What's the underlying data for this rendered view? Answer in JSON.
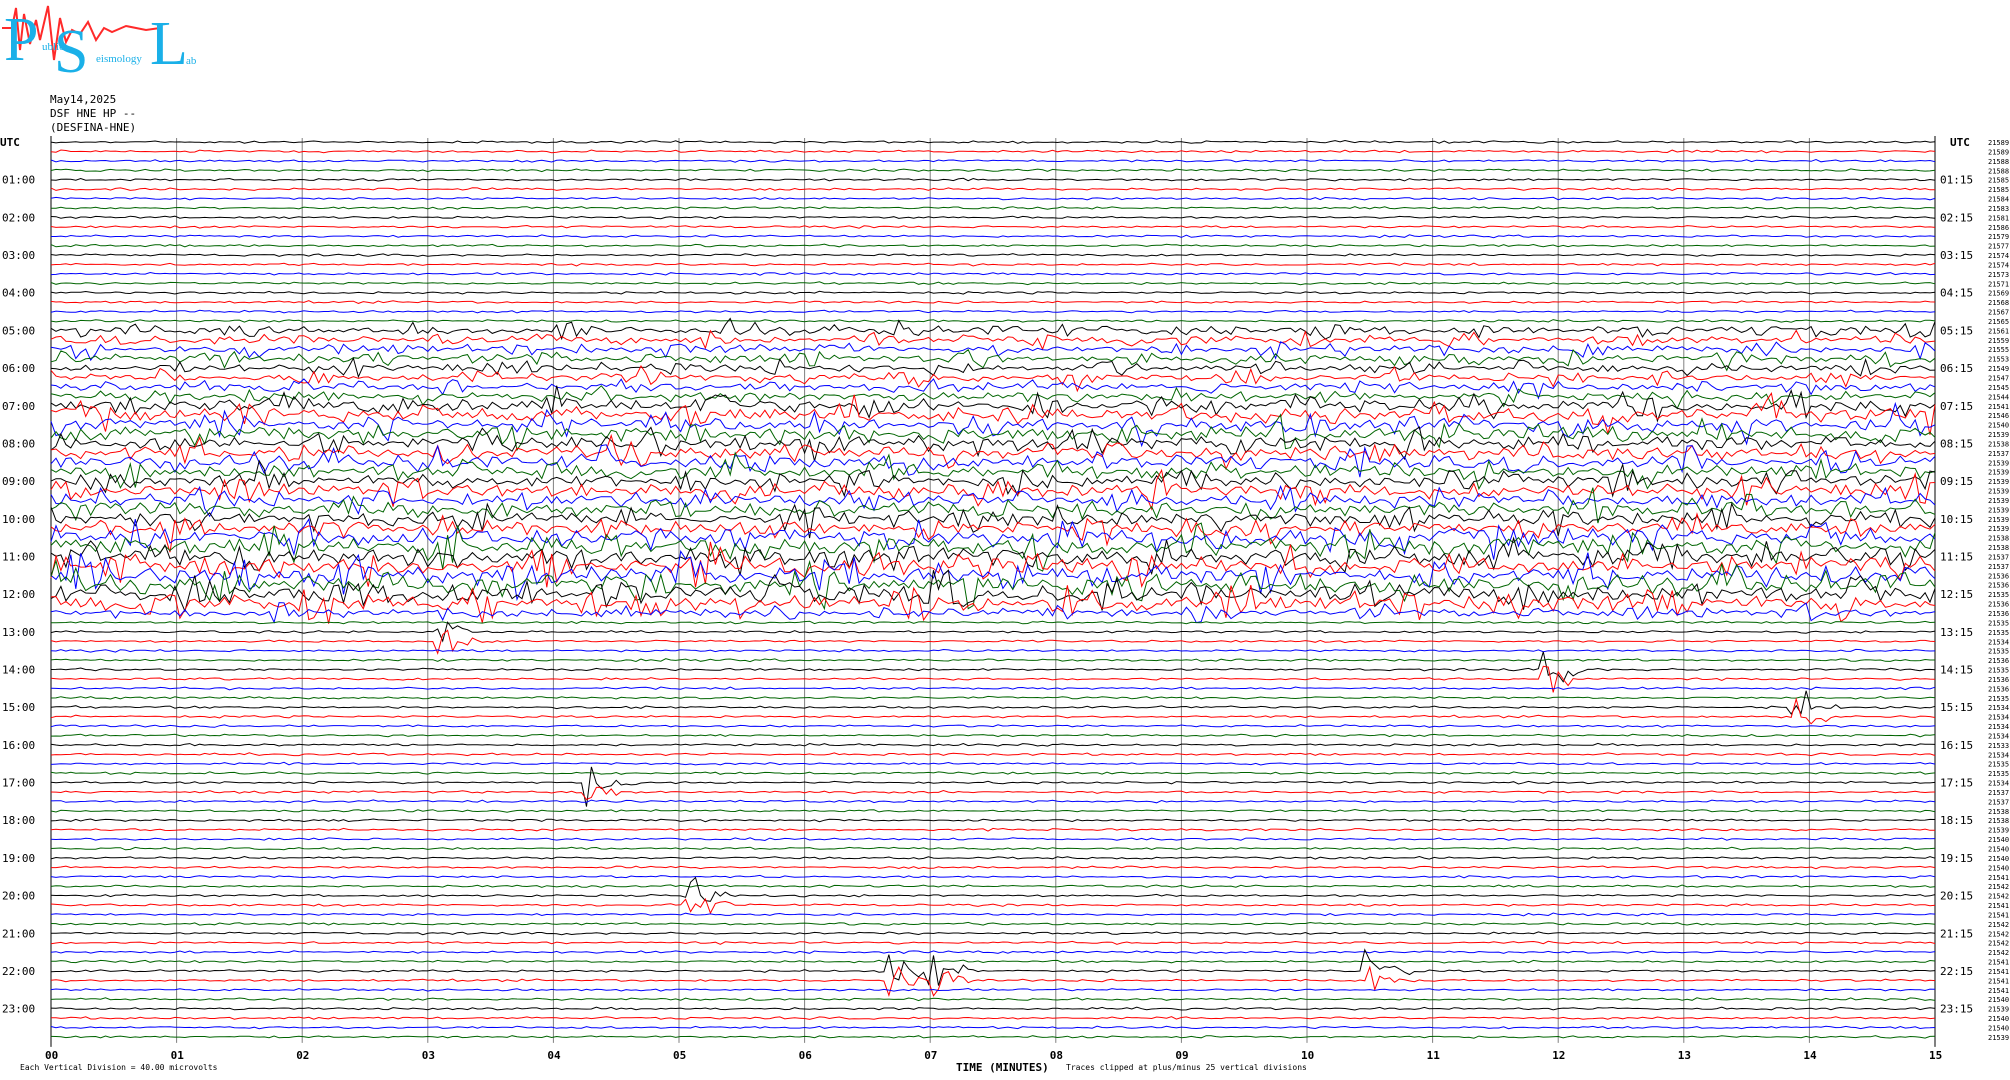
{
  "logo": {
    "letters": [
      "P",
      "S",
      "L"
    ],
    "words": [
      "ublic",
      "eismology",
      "ab"
    ]
  },
  "header": {
    "date": "May14,2025",
    "station": "DSF HNE HP --",
    "channel": "(DESFINA-HNE)"
  },
  "colors": {
    "trace_cycle": [
      "#000000",
      "#ff0000",
      "#0000ff",
      "#006400"
    ],
    "grid": "#808080",
    "text": "#000000"
  },
  "chart_data": {
    "type": "line",
    "subtype": "helicorder",
    "xlabel": "TIME (MINUTES)",
    "xlim": [
      0,
      15
    ],
    "x_ticks": [
      "00",
      "01",
      "02",
      "03",
      "04",
      "05",
      "06",
      "07",
      "08",
      "09",
      "10",
      "11",
      "12",
      "13",
      "14",
      "15"
    ],
    "utc_label": "UTC",
    "left_hour_labels": [
      "01:00",
      "02:00",
      "03:00",
      "04:00",
      "05:00",
      "06:00",
      "07:00",
      "08:00",
      "09:00",
      "10:00",
      "11:00",
      "12:00",
      "13:00",
      "14:00",
      "15:00",
      "16:00",
      "17:00",
      "18:00",
      "19:00",
      "20:00",
      "21:00",
      "22:00",
      "23:00"
    ],
    "right_hour_labels": [
      "01:15",
      "02:15",
      "03:15",
      "04:15",
      "05:15",
      "06:15",
      "07:15",
      "08:15",
      "09:15",
      "10:15",
      "11:15",
      "12:15",
      "13:15",
      "14:15",
      "15:15",
      "16:15",
      "17:15",
      "18:15",
      "19:15",
      "20:15",
      "21:15",
      "22:15",
      "23:15"
    ],
    "trace_count": 96,
    "trace_minutes": 15,
    "right_counts": [
      21589,
      21589,
      21588,
      21588,
      21585,
      21585,
      21584,
      21583,
      21581,
      21586,
      21579,
      21577,
      21574,
      21574,
      21573,
      21571,
      21569,
      21568,
      21567,
      21565,
      21561,
      21559,
      21555,
      21553,
      21549,
      21547,
      21545,
      21544,
      21541,
      21546,
      21540,
      21539,
      21538,
      21537,
      21539,
      21539,
      21539,
      21539,
      21539,
      21539,
      21539,
      21539,
      21538,
      21538,
      21537,
      21537,
      21536,
      21536,
      21535,
      21536,
      21536,
      21535,
      21535,
      21534,
      21535,
      21536,
      21535,
      21536,
      21536,
      21535,
      21534,
      21534,
      21534,
      21534,
      21533,
      21534,
      21535,
      21535,
      21534,
      21537,
      21537,
      21538,
      21538,
      21539,
      21540,
      21540,
      21540,
      21540,
      21541,
      21542,
      21542,
      21541,
      21541,
      21542,
      21542,
      21542,
      21542,
      21541,
      21541,
      21541,
      21541,
      21540,
      21539,
      21540,
      21540,
      21539
    ],
    "activity_note_hours": "strong tremor bursts between 05:00 and 12:30 UTC",
    "events": [
      {
        "hour": 13,
        "minute": 3.1
      },
      {
        "hour": 14,
        "minute": 11.9
      },
      {
        "hour": 15,
        "minute": 13.9
      },
      {
        "hour": 17,
        "minute": 4.3
      },
      {
        "hour": 20,
        "minute": 5.1
      },
      {
        "hour": 22,
        "minute": 6.7
      },
      {
        "hour": 22,
        "minute": 7.0
      },
      {
        "hour": 22,
        "minute": 10.5
      }
    ],
    "footer_left": "Each Vertical Division =    40.00 microvolts",
    "footer_clip": "Traces clipped at plus/minus 25 vertical divisions"
  }
}
